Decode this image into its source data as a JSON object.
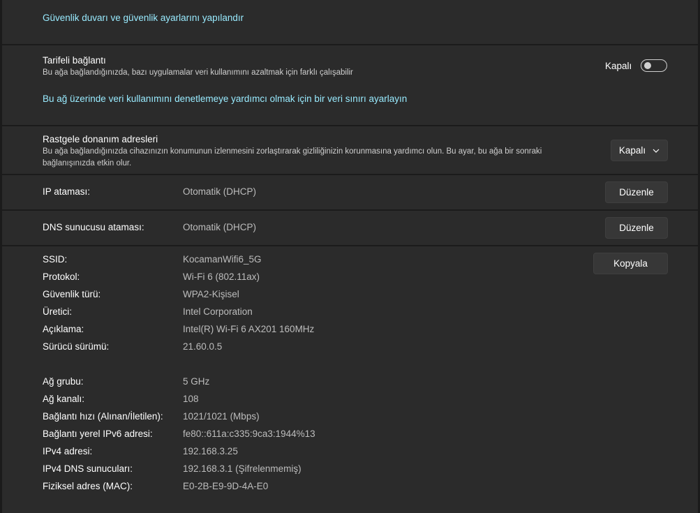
{
  "firewall": {
    "link": "Güvenlik duvarı ve güvenlik ayarlarını yapılandır"
  },
  "metered": {
    "title": "Tarifeli bağlantı",
    "description": "Bu ağa bağlandığınızda, bazı uygulamalar veri kullanımını azaltmak için farklı çalışabilir",
    "toggle_label": "Kapalı",
    "toggle_on": false,
    "data_limit_link": "Bu ağ üzerinde veri kullanımını denetlemeye yardımcı olmak için bir veri sınırı ayarlayın"
  },
  "random_hw": {
    "title": "Rastgele donanım adresleri",
    "description_line1": "Bu ağa bağlandığınızda cihazınızın konumunun izlenmesini zorlaştırarak gizliliğinizin korunmasına yardımcı olun. Bu ayar, bu ağa bir sonraki",
    "description_line2": "bağlanışınızda etkin olur.",
    "dropdown_value": "Kapalı"
  },
  "ip_assignment": {
    "label": "IP ataması:",
    "value": "Otomatik (DHCP)",
    "button": "Düzenle"
  },
  "dns_assignment": {
    "label": "DNS sunucusu ataması:",
    "value": "Otomatik (DHCP)",
    "button": "Düzenle"
  },
  "properties": {
    "copy_button": "Kopyala",
    "rows": [
      {
        "label": "SSID:",
        "value": "KocamanWifi6_5G"
      },
      {
        "label": "Protokol:",
        "value": "Wi-Fi 6 (802.11ax)"
      },
      {
        "label": "Güvenlik türü:",
        "value": "WPA2-Kişisel"
      },
      {
        "label": "Üretici:",
        "value": "Intel Corporation"
      },
      {
        "label": "Açıklama:",
        "value": "Intel(R) Wi-Fi 6 AX201 160MHz"
      },
      {
        "label": "Sürücü sürümü:",
        "value": "21.60.0.5"
      },
      {
        "label": "Ağ grubu:",
        "value": "5 GHz"
      },
      {
        "label": "Ağ kanalı:",
        "value": "108"
      },
      {
        "label": "Bağlantı hızı (Alınan/İletilen):",
        "value": "1021/1021 (Mbps)"
      },
      {
        "label": "Bağlantı yerel IPv6 adresi:",
        "value": "fe80::611a:c335:9ca3:1944%13"
      },
      {
        "label": "IPv4 adresi:",
        "value": "192.168.3.25"
      },
      {
        "label": "IPv4 DNS sunucuları:",
        "value": "192.168.3.1 (Şifrelenmemiş)"
      },
      {
        "label": "Fiziksel adres (MAC):",
        "value": "E0-2B-E9-9D-4A-E0"
      }
    ]
  }
}
